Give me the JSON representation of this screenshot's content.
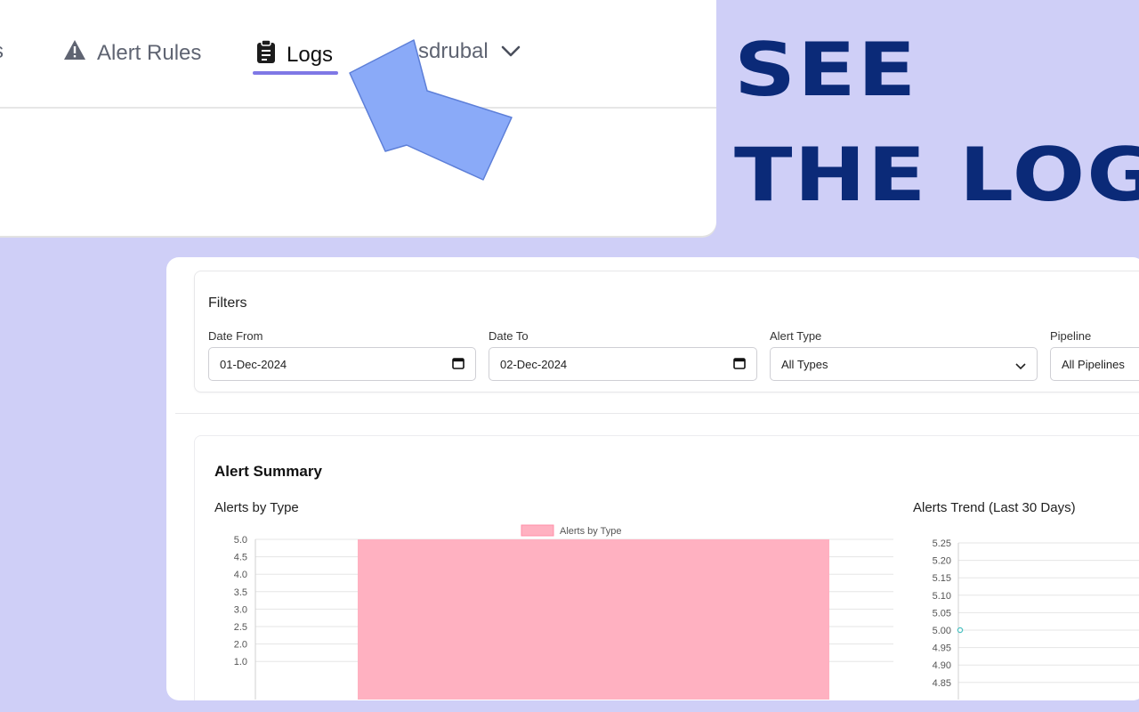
{
  "nav": {
    "truncated_item": "s",
    "alert_rules": "Alert Rules",
    "logs": "Logs",
    "user": "sdrubal"
  },
  "headline": {
    "line1": "SEE",
    "line2": "THE LOG"
  },
  "filters": {
    "title": "Filters",
    "date_from": {
      "label": "Date From",
      "value": "01-Dec-2024"
    },
    "date_to": {
      "label": "Date To",
      "value": "02-Dec-2024"
    },
    "alert_type": {
      "label": "Alert Type",
      "value": "All Types"
    },
    "pipeline": {
      "label": "Pipeline",
      "value": "All Pipelines"
    }
  },
  "summary": {
    "title": "Alert Summary",
    "bar_chart_title": "Alerts by Type",
    "trend_chart_title": "Alerts Trend (Last 30 Days)"
  },
  "colors": {
    "background": "#cfcff7",
    "headline": "#0b2a78",
    "accent_underline": "#7f78e6",
    "pointer_arrow": "#8aaaf8",
    "bar_fill": "#ffb1c1",
    "trend_point": "#4bc0c0"
  },
  "icons": {
    "alert_rules": "warning-triangle-icon",
    "logs": "clipboard-icon",
    "user_menu": "chevron-down-icon",
    "date": "calendar-icon",
    "select": "chevron-down-icon"
  },
  "chart_data": [
    {
      "type": "bar",
      "title": "Alerts by Type",
      "legend": [
        "Alerts by Type"
      ],
      "legend_position": "top",
      "series": [
        {
          "name": "Alerts by Type",
          "values": [
            5
          ]
        }
      ],
      "categories": [
        ""
      ],
      "yticks": [
        "5.0",
        "4.5",
        "4.0",
        "3.5",
        "3.0",
        "2.5",
        "2.0",
        "1.0"
      ],
      "ylim": [
        0,
        5
      ],
      "grid": true
    },
    {
      "type": "line",
      "title": "Alerts Trend (Last 30 Days)",
      "points": [
        {
          "x": 0,
          "y": 5.0
        }
      ],
      "yticks": [
        "5.25",
        "5.20",
        "5.15",
        "5.10",
        "5.05",
        "5.00",
        "4.95",
        "4.90",
        "4.85"
      ],
      "ylim": [
        4.85,
        5.25
      ],
      "grid": true
    }
  ]
}
